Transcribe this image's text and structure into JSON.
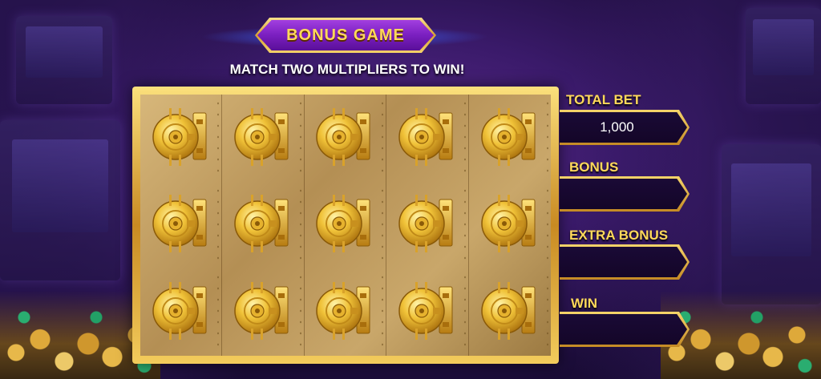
{
  "header": {
    "title": "BONUS GAME",
    "instruction": "MATCH TWO MULTIPLIERS TO WIN!"
  },
  "board": {
    "rows": 3,
    "columns": 5,
    "tile_icon": "vault-door-icon",
    "tiles": [
      {
        "state": "closed"
      },
      {
        "state": "closed"
      },
      {
        "state": "closed"
      },
      {
        "state": "closed"
      },
      {
        "state": "closed"
      },
      {
        "state": "closed"
      },
      {
        "state": "closed"
      },
      {
        "state": "closed"
      },
      {
        "state": "closed"
      },
      {
        "state": "closed"
      },
      {
        "state": "closed"
      },
      {
        "state": "closed"
      },
      {
        "state": "closed"
      },
      {
        "state": "closed"
      },
      {
        "state": "closed"
      }
    ]
  },
  "panel": {
    "total_bet": {
      "label": "TOTAL BET",
      "value": "1,000"
    },
    "bonus": {
      "label": "BONUS",
      "value": ""
    },
    "extra_bonus": {
      "label": "EXTRA BONUS",
      "value": ""
    },
    "win": {
      "label": "WIN",
      "value": ""
    }
  },
  "colors": {
    "accent_gold": "#ffd95a",
    "title_purple": "#7a1fc0",
    "field_dark": "#1a0a36"
  }
}
